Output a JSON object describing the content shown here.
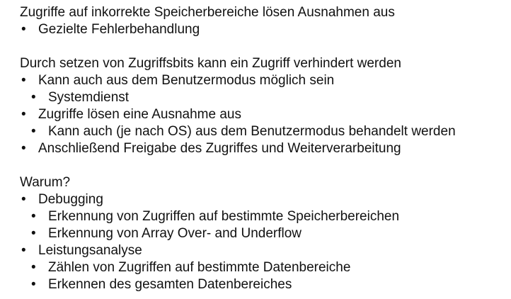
{
  "bullet_glyph": "•",
  "section1": {
    "heading": "Zugriffe auf inkorrekte Speicherbereiche lösen Ausnahmen aus",
    "items": [
      {
        "text": "Gezielte Fehlerbehandlung"
      }
    ]
  },
  "section2": {
    "heading": "Durch setzen von Zugriffsbits kann ein Zugriff verhindert werden",
    "items": [
      {
        "text": "Kann auch aus dem Benutzermodus möglich sein"
      },
      {
        "text": "Systemdienst"
      },
      {
        "text": "Zugriffe lösen eine Ausnahme aus"
      },
      {
        "text": "Kann auch (je nach OS) aus dem Benutzermodus behandelt werden"
      },
      {
        "text": "Anschließend Freigabe des Zugriffes und Weiterverarbeitung"
      }
    ]
  },
  "section3": {
    "heading": "Warum?",
    "items": [
      {
        "text": "Debugging"
      },
      {
        "text": "Erkennung von Zugriffen auf bestimmte Speicherbereichen"
      },
      {
        "text": "Erkennung von Array Over- and Underflow"
      },
      {
        "text": "Leistungsanalyse"
      },
      {
        "text": "Zählen von Zugriffen auf bestimmte Datenbereiche"
      },
      {
        "text": "Erkennen des gesamten Datenbereiches"
      }
    ]
  }
}
